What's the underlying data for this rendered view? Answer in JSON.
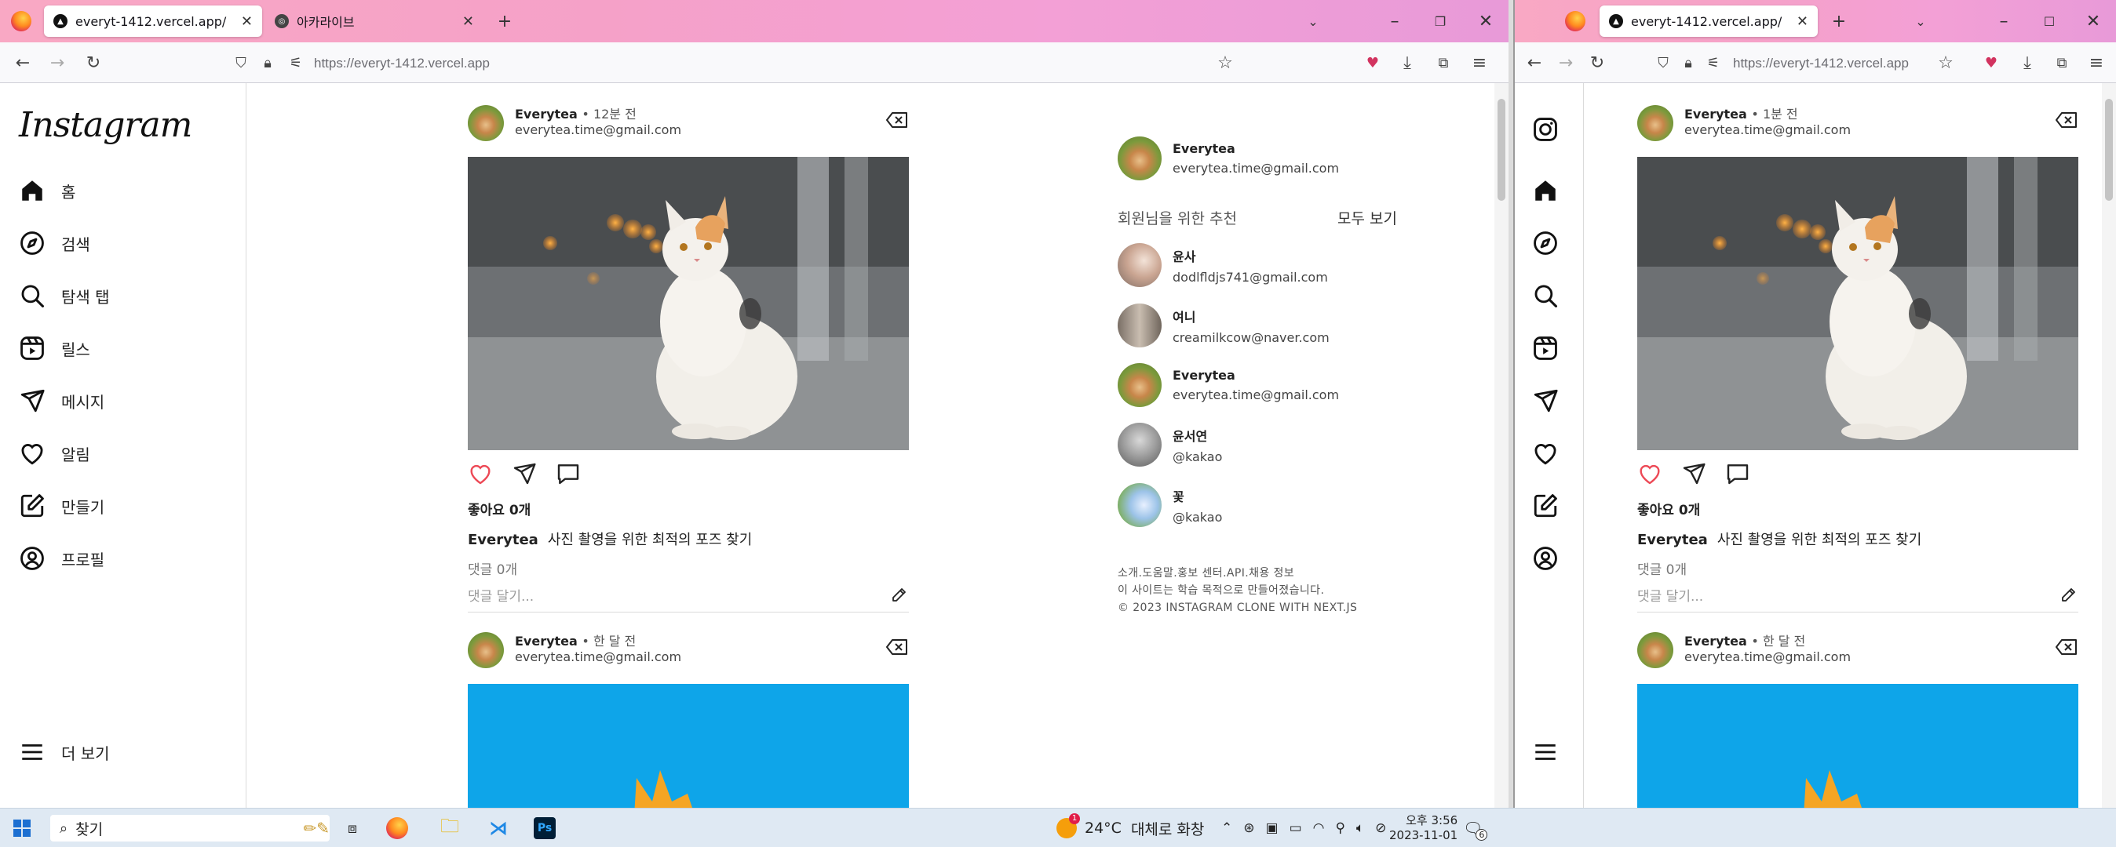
{
  "left_window": {
    "tabs": [
      {
        "label": "everyt-1412.vercel.app/",
        "active": true
      },
      {
        "label": "아카라이브",
        "active": false
      }
    ],
    "url": "https://everyt-1412.vercel.app"
  },
  "right_window": {
    "tabs": [
      {
        "label": "everyt-1412.vercel.app/",
        "active": true
      }
    ],
    "url": "https://everyt-1412.vercel.app"
  },
  "sidebar": {
    "logo": "Instagram",
    "items": [
      {
        "label": "홈",
        "icon": "home-icon"
      },
      {
        "label": "검색",
        "icon": "compass-icon"
      },
      {
        "label": "탐색 탭",
        "icon": "search-icon"
      },
      {
        "label": "릴스",
        "icon": "reels-icon"
      },
      {
        "label": "메시지",
        "icon": "send-icon"
      },
      {
        "label": "알림",
        "icon": "heart-icon"
      },
      {
        "label": "만들기",
        "icon": "create-icon"
      },
      {
        "label": "프로필",
        "icon": "profile-icon"
      }
    ],
    "more": "더 보기"
  },
  "posts_left": [
    {
      "user": "Everytea",
      "time": "12분 전",
      "email": "everytea.time@gmail.com",
      "likes": "좋아요 0개",
      "caption_user": "Everytea",
      "caption": "사진 촬영을 위한 최적의 포즈 찾기",
      "comments": "댓글 0개",
      "add_comment": "댓글 달기..."
    },
    {
      "user": "Everytea",
      "time": "한 달 전",
      "email": "everytea.time@gmail.com"
    }
  ],
  "posts_right": [
    {
      "user": "Everytea",
      "time": "1분 전",
      "email": "everytea.time@gmail.com",
      "likes": "좋아요 0개",
      "caption_user": "Everytea",
      "caption": "사진 촬영을 위한 최적의 포즈 찾기",
      "comments": "댓글 0개",
      "add_comment": "댓글 달기..."
    },
    {
      "user": "Everytea",
      "time": "한 달 전",
      "email": "everytea.time@gmail.com"
    }
  ],
  "right_column": {
    "me": {
      "name": "Everytea",
      "email": "everytea.time@gmail.com"
    },
    "rec_title": "회원님을 위한 추천",
    "see_all": "모두 보기",
    "suggestions": [
      {
        "name": "윤사",
        "email": "dodlfldjs741@gmail.com"
      },
      {
        "name": "여니",
        "email": "creamilkcow@naver.com"
      },
      {
        "name": "Everytea",
        "email": "everytea.time@gmail.com"
      },
      {
        "name": "윤서연",
        "email": "@kakao"
      },
      {
        "name": "꽃",
        "email": "@kakao"
      }
    ],
    "footer_links": "소개.도움말.홍보 센터.API.채용 정보",
    "footer_note": "이 사이트는 학습 목적으로 만들어졌습니다.",
    "footer_copy": "© 2023 INSTAGRAM CLONE WITH NEXT.JS"
  },
  "taskbar": {
    "search": "찾기",
    "weather_temp": "24°C",
    "weather_text": "대체로 화창",
    "weather_badge": "1",
    "time": "오후 3:56",
    "date": "2023-11-01",
    "notif_count": "6"
  },
  "colors": {
    "like_red": "#ed4956",
    "post_blue": "#0ea5e9",
    "accent_orange": "#f5a524"
  }
}
